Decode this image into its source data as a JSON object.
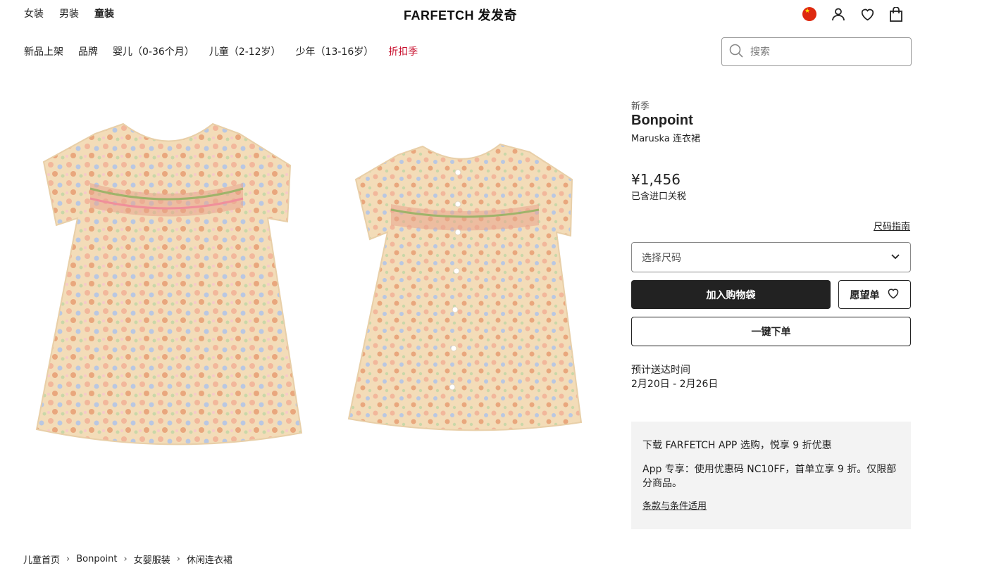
{
  "top_nav": {
    "women": "女装",
    "men": "男装",
    "kids": "童装"
  },
  "logo": "FARFETCH 发发奇",
  "header_icons": [
    "china-flag-icon",
    "account-icon",
    "wishlist-heart-icon",
    "shopping-bag-icon"
  ],
  "category_nav": [
    {
      "label": "新品上架"
    },
    {
      "label": "品牌"
    },
    {
      "label": "婴儿（0-36个月）"
    },
    {
      "label": "儿童（2-12岁）"
    },
    {
      "label": "少年（13-16岁）"
    },
    {
      "label": "折扣季"
    }
  ],
  "search": {
    "placeholder": "搜索"
  },
  "product": {
    "season": "新季",
    "brand": "Bonpoint",
    "name": "Maruska 连衣裙",
    "price": "¥1,456",
    "tax_note": "已含进口关税",
    "size_guide": "尺码指南",
    "size_select": "选择尺码",
    "add_to_bag": "加入购物袋",
    "wishlist": "愿望单",
    "one_click": "一键下单",
    "delivery_label": "预计送达时间",
    "delivery_date": "2月20日 - 2月26日"
  },
  "promo": {
    "title": "下载 FARFETCH APP 选购，悦享 9 折优惠",
    "body": "App 专享：使用优惠码 NC10FF，首单立享 9 折。仅限部分商品。",
    "terms": "条款与条件适用"
  },
  "breadcrumbs": [
    "儿童首页",
    "Bonpoint",
    "女婴服装",
    "休闲连衣裙"
  ],
  "colors": {
    "sale": "#c8102e",
    "primary_button": "#222222",
    "promo_bg": "#f3f3f3"
  }
}
